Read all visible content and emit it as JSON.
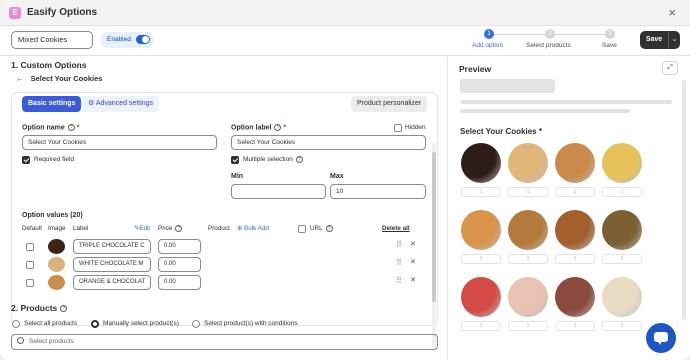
{
  "app": {
    "title": "Easify Options",
    "icon_letter": "E",
    "close_label": "×"
  },
  "toolbar": {
    "name_value": "Mixed Cookies",
    "enabled_label": "Enabled",
    "steps": [
      {
        "number": "1",
        "label": "Add option",
        "active": true
      },
      {
        "number": "2",
        "label": "Select products",
        "active": false
      },
      {
        "number": "3",
        "label": "Save",
        "active": false
      }
    ],
    "save_label": "Save",
    "save_dropdown_icon": "⌄"
  },
  "custom_options": {
    "heading": "1. Custom Options",
    "back_label": "Select Your Cookies",
    "back_icon": "←",
    "tabs": {
      "basic": "Basic settings",
      "advanced": "Advanced settings",
      "personalizer": "Product personalizer"
    },
    "option_name_label": "Option name",
    "option_name_value": "Select Your Cookies",
    "option_label_label": "Option label",
    "option_label_value": "Select Your Cookies",
    "hidden_label": "Hidden",
    "required_label": "Required field",
    "multiple_label": "Multiple selection",
    "min_label": "Min",
    "min_value": "",
    "max_label": "Max",
    "max_value": "10",
    "values_heading": "Option values (20)",
    "columns": {
      "default": "Default",
      "image": "Image",
      "label": "Label",
      "edit": "Edit",
      "price": "Price",
      "product": "Product",
      "bulk_add": "Bulk Add",
      "url": "URL",
      "delete_all": "Delete all"
    },
    "rows": [
      {
        "label": "TRIPLE CHOCOLATE C",
        "price": "0.00",
        "color": "#3a2418"
      },
      {
        "label": "WHITE CHOCOLATE M",
        "price": "0.00",
        "color": "#d9b27c"
      },
      {
        "label": "ORANGE & CHOCOLAT",
        "price": "0.00",
        "color": "#c98d4c"
      }
    ]
  },
  "products": {
    "heading": "2. Products",
    "options": [
      "Select all products",
      "Manually select product(s)",
      "Select product(s) with conditions"
    ],
    "selected_index": 1,
    "search_placeholder": "Select products"
  },
  "preview": {
    "title": "Preview",
    "expand_icon": "⤢",
    "option_title": "Select Your Cookies",
    "required_mark": "*",
    "qty_placeholder": "1",
    "cookie_colors": [
      "#2e1d18",
      "#e2b57a",
      "#c98a4c",
      "#e6c25a",
      "#d9934a",
      "#b37a3c",
      "#a3602f",
      "#7a6032",
      "#d44a44",
      "#e8c2b2",
      "#8a4a3c",
      "#e9dbc4"
    ]
  }
}
